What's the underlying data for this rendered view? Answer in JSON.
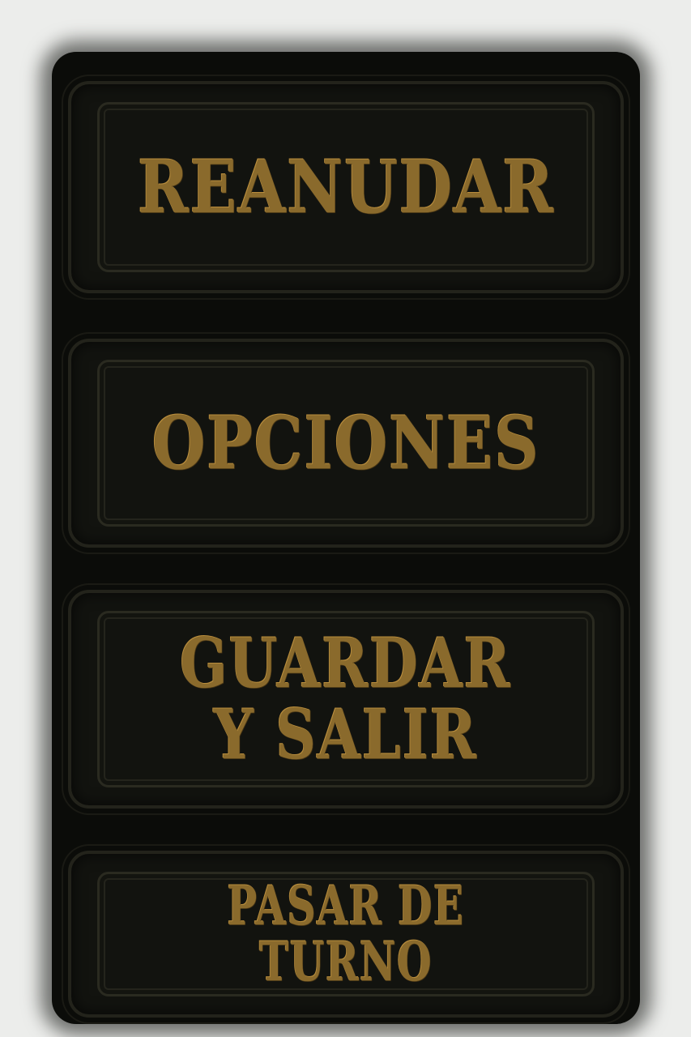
{
  "menu": {
    "items": [
      {
        "label": "REANUDAR"
      },
      {
        "label": "OPCIONES"
      },
      {
        "label": "GUARDAR\nY SALIR"
      },
      {
        "label": "PASAR DE TURNO"
      }
    ]
  },
  "colors": {
    "background": "#ecedeb",
    "panel": "#0b0c09",
    "button": "#12130f",
    "text_gold": "#8a6a2c"
  }
}
